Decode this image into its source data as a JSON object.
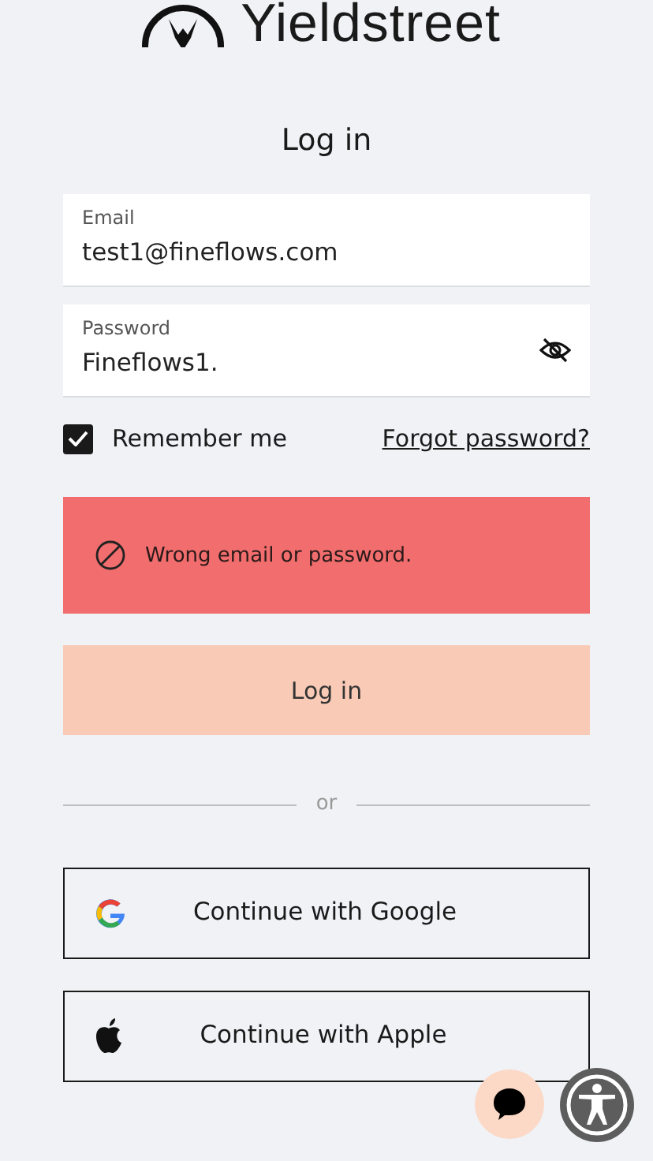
{
  "brand": {
    "name": "Yieldstreet"
  },
  "title": "Log in",
  "fields": [
    {
      "label": "Email",
      "value": "test1@fineflows.com",
      "kind": "text"
    },
    {
      "label": "Password",
      "value": "Fineflows1.",
      "kind": "password"
    }
  ],
  "remember": {
    "label": "Remember me",
    "checked": true
  },
  "forgot_link": "Forgot password?",
  "error": "Wrong email or password.",
  "submit": {
    "label": "Log in",
    "disabled": true
  },
  "divider": "or",
  "social_buttons": [
    {
      "label": "Continue with Google",
      "kind": "google"
    },
    {
      "label": "Continue with Apple",
      "kind": "apple"
    }
  ]
}
